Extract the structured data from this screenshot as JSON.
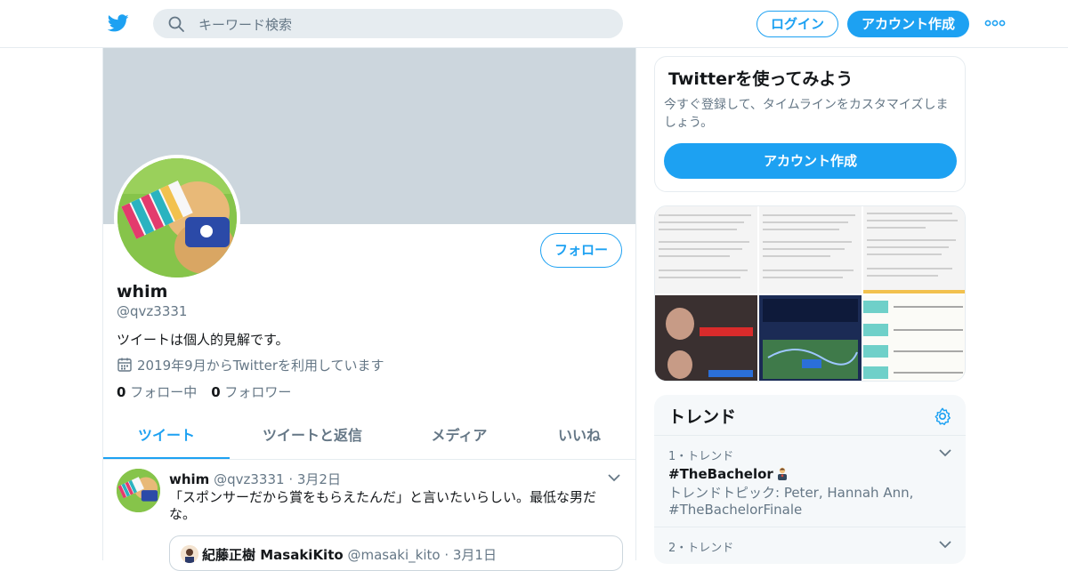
{
  "header": {
    "search_placeholder": "キーワード検索",
    "login_label": "ログイン",
    "signup_label": "アカウント作成"
  },
  "profile": {
    "follow_label": "フォロー",
    "name": "whim",
    "handle": "@qvz3331",
    "bio": "ツイートは個人的見解です。",
    "joined": "2019年9月からTwitterを利用しています",
    "following_count": "0",
    "following_label": " フォロー中",
    "followers_count": "0",
    "followers_label": " フォロワー"
  },
  "tabs": [
    {
      "label": "ツイート",
      "active": true
    },
    {
      "label": "ツイートと返信",
      "active": false
    },
    {
      "label": "メディア",
      "active": false
    },
    {
      "label": "いいね",
      "active": false
    }
  ],
  "tweet": {
    "name": "whim",
    "handle": "@qvz3331",
    "date": "· 3月2日",
    "text": "「スポンサーだから賞をもらえたんだ」と言いたいらしい。最低な男だな。",
    "quote": {
      "name": "紀藤正樹 MasakiKito",
      "handle": "@masaki_kito",
      "date": "· 3月1日"
    }
  },
  "signup_card": {
    "title": "Twitterを使ってみよう",
    "subtitle": "今すぐ登録して、タイムラインをカスタマイズしましょう。",
    "button": "アカウント作成"
  },
  "trends": {
    "title": "トレンド",
    "items": [
      {
        "meta": "1・トレンド",
        "name": "#TheBachelor",
        "extra": "トレンドトピック: Peter, Hannah Ann, #TheBachelorFinale"
      },
      {
        "meta": "2・トレンド",
        "name": "",
        "extra": ""
      }
    ]
  },
  "colors": {
    "accent": "#1da1f2",
    "banner": "#ccd6dd",
    "muted": "#657786",
    "border": "#e6ecf0"
  }
}
